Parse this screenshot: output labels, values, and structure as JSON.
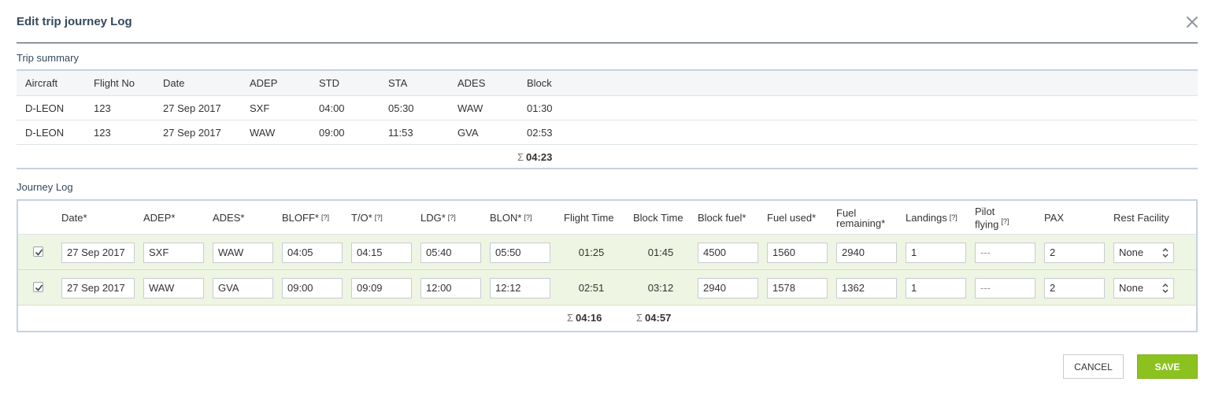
{
  "dialog": {
    "title": "Edit trip journey Log",
    "close_icon": "close-icon"
  },
  "trip_summary": {
    "label": "Trip summary",
    "headers": [
      "Aircraft",
      "Flight No",
      "Date",
      "ADEP",
      "STD",
      "STA",
      "ADES",
      "Block"
    ],
    "rows": [
      [
        "D-LEON",
        "123",
        "27 Sep 2017",
        "SXF",
        "04:00",
        "05:30",
        "WAW",
        "01:30"
      ],
      [
        "D-LEON",
        "123",
        "27 Sep 2017",
        "WAW",
        "09:00",
        "11:53",
        "GVA",
        "02:53"
      ]
    ],
    "sigma": "Σ",
    "total_block": "04:23"
  },
  "journey_log": {
    "label": "Journey Log",
    "headers": {
      "date": "Date*",
      "adep": "ADEP*",
      "ades": "ADES*",
      "bloff": "BLOFF*",
      "to": "T/O*",
      "ldg": "LDG*",
      "blon": "BLON*",
      "flight_time": "Flight Time",
      "block_time": "Block Time",
      "block_fuel": "Block fuel*",
      "fuel_used": "Fuel used*",
      "fuel_remaining_1": "Fuel",
      "fuel_remaining_2": "remaining*",
      "landings": "Landings",
      "pilot_flying_1": "Pilot",
      "pilot_flying_2": "flying",
      "pax": "PAX",
      "rest_facility": "Rest Facility"
    },
    "hint": "[?]",
    "rows": [
      {
        "checked": true,
        "date": "27 Sep 2017",
        "adep": "SXF",
        "ades": "WAW",
        "bloff": "04:05",
        "to": "04:15",
        "ldg": "05:40",
        "blon": "05:50",
        "flight_time": "01:25",
        "block_time": "01:45",
        "block_fuel": "4500",
        "fuel_used": "1560",
        "fuel_remaining": "2940",
        "landings": "1",
        "pilot_flying": "---",
        "pax": "2",
        "rest_facility": "None"
      },
      {
        "checked": true,
        "date": "27 Sep 2017",
        "adep": "WAW",
        "ades": "GVA",
        "bloff": "09:00",
        "to": "09:09",
        "ldg": "12:00",
        "blon": "12:12",
        "flight_time": "02:51",
        "block_time": "03:12",
        "block_fuel": "2940",
        "fuel_used": "1578",
        "fuel_remaining": "1362",
        "landings": "1",
        "pilot_flying": "---",
        "pax": "2",
        "rest_facility": "None"
      }
    ],
    "sigma": "Σ",
    "total_flight_time": "04:16",
    "total_block_time": "04:57"
  },
  "buttons": {
    "cancel": "CANCEL",
    "save": "SAVE"
  },
  "colors": {
    "row_highlight": "#eef5e2",
    "save_button": "#8cc21f",
    "title": "#34495e",
    "border": "#c5d2e0"
  }
}
